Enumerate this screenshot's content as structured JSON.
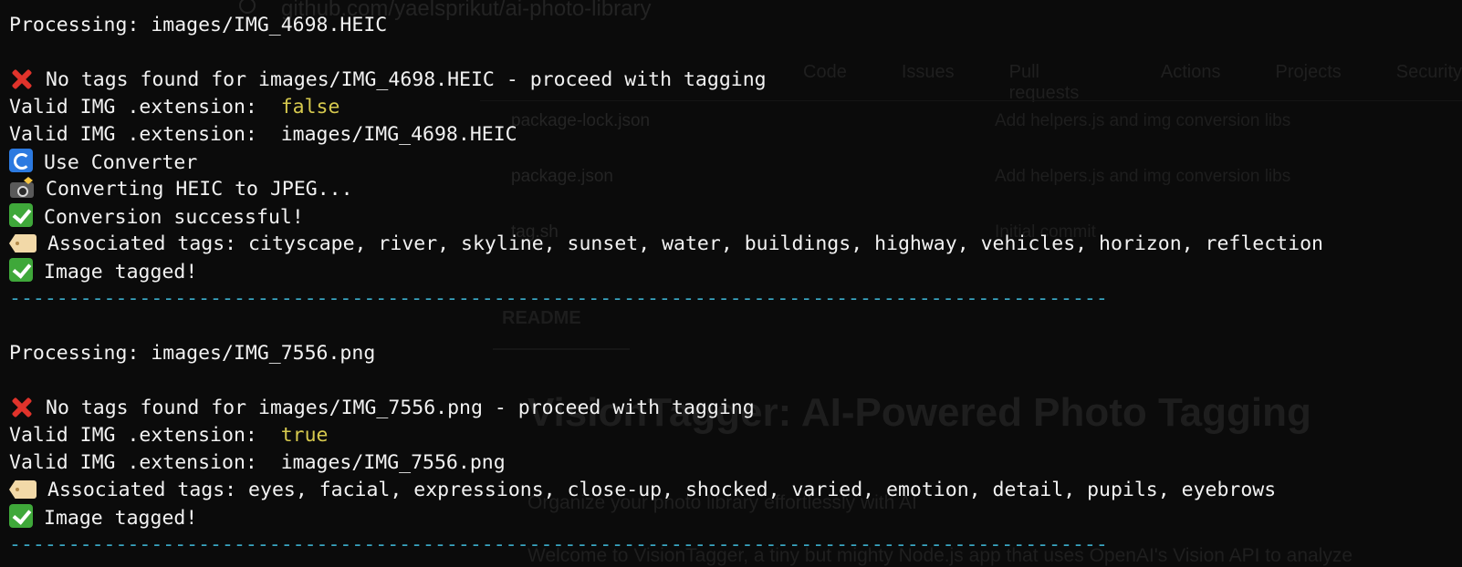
{
  "background": {
    "address": "github.com/yaelsprikut/ai-photo-library",
    "tabs": [
      "Code",
      "Issues",
      "Pull requests",
      "Actions",
      "Projects",
      "Security"
    ],
    "files": [
      {
        "name": "package-lock.json",
        "message": "Add helpers.js and img conversion libs"
      },
      {
        "name": "package.json",
        "message": "Add helpers.js and img conversion libs"
      },
      {
        "name": "tag.sh",
        "message": "Initial commit"
      }
    ],
    "readme_tab": "README",
    "title": "VisionTagger: AI-Powered Photo Tagging",
    "subtitle": "Organize your photo library effortlessly with AI",
    "welcome": "Welcome to VisionTagger, a tiny but mighty Node.js app that uses OpenAI's Vision API to analyze"
  },
  "terminal": {
    "block1": {
      "processing": "Processing: images/IMG_4698.HEIC",
      "no_tags": "No tags found for images/IMG_4698.HEIC - proceed with tagging",
      "valid_label": "Valid IMG .extension:  ",
      "valid_value": "false",
      "valid2": "Valid IMG .extension:  images/IMG_4698.HEIC",
      "use_converter": "Use Converter",
      "converting": "Converting HEIC to JPEG...",
      "conversion_ok": "Conversion successful!",
      "tags": "Associated tags: cityscape, river, skyline, sunset, water, buildings, highway, vehicles, horizon, reflection",
      "tagged": "Image tagged!"
    },
    "separator": "---------------------------------------------------------------------------------------------",
    "block2": {
      "processing": "Processing: images/IMG_7556.png",
      "no_tags": "No tags found for images/IMG_7556.png - proceed with tagging",
      "valid_label": "Valid IMG .extension:  ",
      "valid_value": "true",
      "valid2": "Valid IMG .extension:  images/IMG_7556.png",
      "tags": "Associated tags: eyes, facial, expressions, close-up, shocked, varied, emotion, detail, pupils, eyebrows",
      "tagged": "Image tagged!"
    },
    "colors": {
      "text": "#f2f2f2",
      "value": "#d6c94e",
      "separator": "#3aa7c4",
      "error": "#e0332b",
      "success": "#3fa83a"
    }
  }
}
